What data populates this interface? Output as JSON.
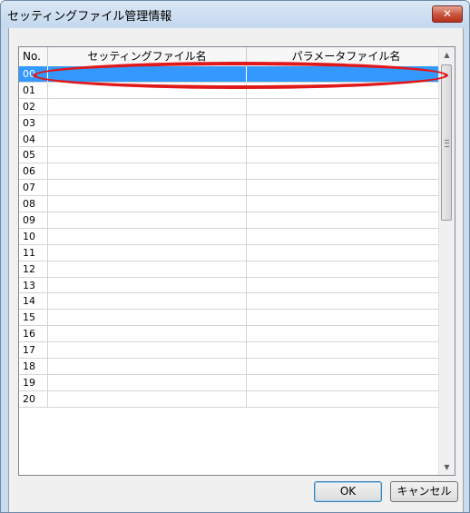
{
  "window": {
    "title": "セッティングファイル管理情報",
    "close_glyph": "✕"
  },
  "grid": {
    "columns": [
      "No.",
      "セッティングファイル名",
      "パラメータファイル名"
    ],
    "rows": [
      {
        "no": "00",
        "setting": "",
        "param": "",
        "selected": true
      },
      {
        "no": "01",
        "setting": "",
        "param": ""
      },
      {
        "no": "02",
        "setting": "",
        "param": ""
      },
      {
        "no": "03",
        "setting": "",
        "param": ""
      },
      {
        "no": "04",
        "setting": "",
        "param": ""
      },
      {
        "no": "05",
        "setting": "",
        "param": ""
      },
      {
        "no": "06",
        "setting": "",
        "param": ""
      },
      {
        "no": "07",
        "setting": "",
        "param": ""
      },
      {
        "no": "08",
        "setting": "",
        "param": ""
      },
      {
        "no": "09",
        "setting": "",
        "param": ""
      },
      {
        "no": "10",
        "setting": "",
        "param": ""
      },
      {
        "no": "11",
        "setting": "",
        "param": ""
      },
      {
        "no": "12",
        "setting": "",
        "param": ""
      },
      {
        "no": "13",
        "setting": "",
        "param": ""
      },
      {
        "no": "14",
        "setting": "",
        "param": ""
      },
      {
        "no": "15",
        "setting": "",
        "param": ""
      },
      {
        "no": "16",
        "setting": "",
        "param": ""
      },
      {
        "no": "17",
        "setting": "",
        "param": ""
      },
      {
        "no": "18",
        "setting": "",
        "param": ""
      },
      {
        "no": "19",
        "setting": "",
        "param": ""
      },
      {
        "no": "20",
        "setting": "",
        "param": ""
      }
    ],
    "scroll_up_glyph": "▲",
    "scroll_down_glyph": "▼"
  },
  "buttons": {
    "ok": "OK",
    "cancel": "キャンセル"
  },
  "colors": {
    "selection": "#3399ff",
    "highlight_ring": "#e0181a"
  }
}
